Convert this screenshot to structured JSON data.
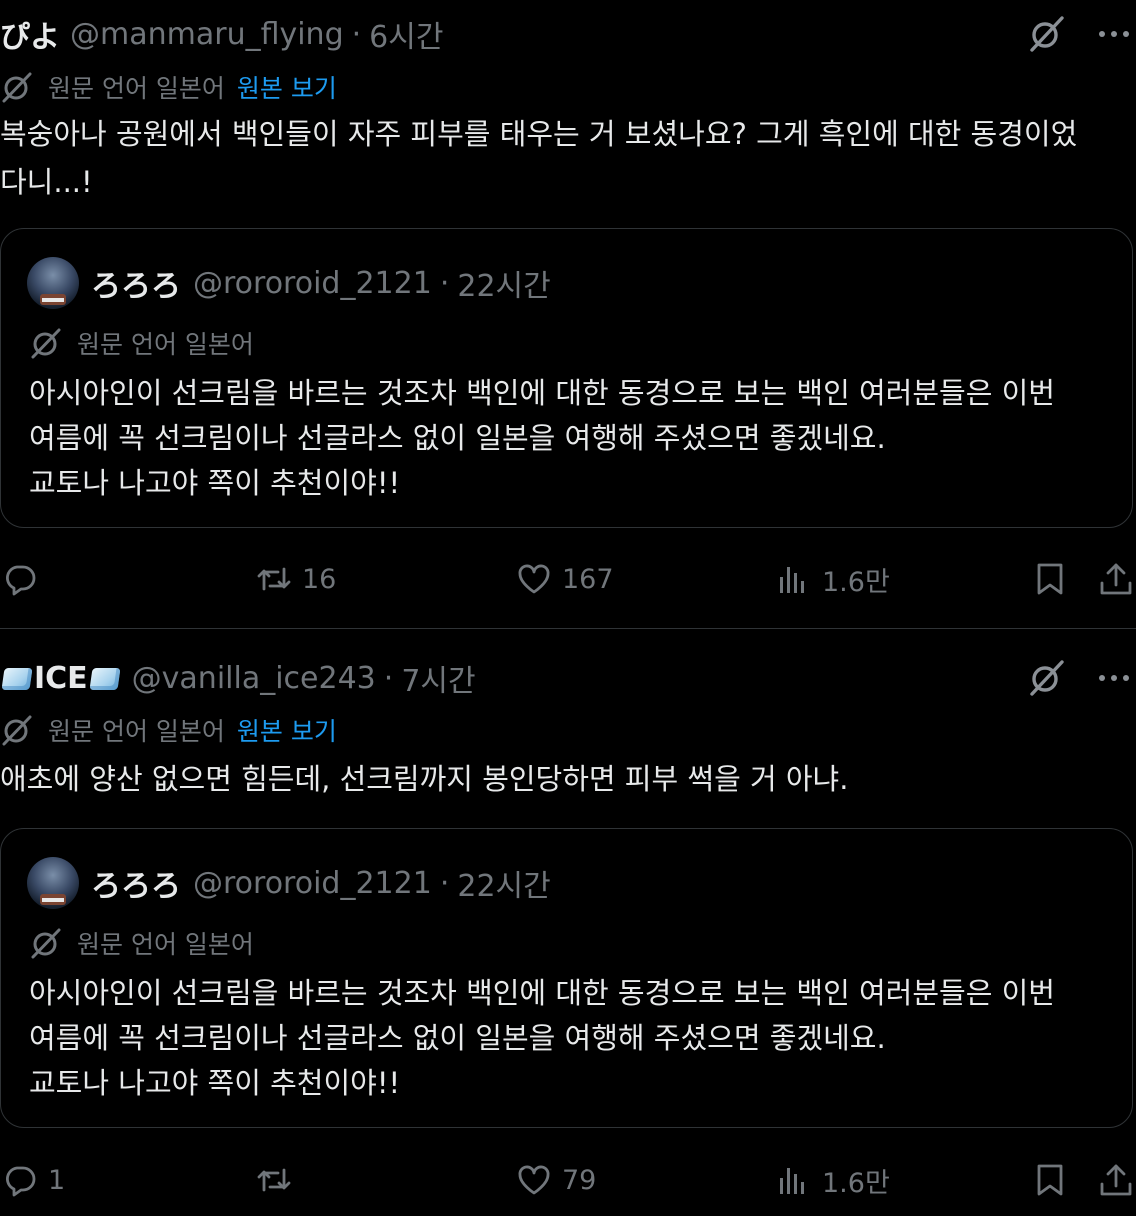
{
  "ui": {
    "translate_label": "원문 언어 일본어",
    "show_original": "원본 보기"
  },
  "posts": [
    {
      "author_name": "ぴよ",
      "handle": "@manmaru_flying",
      "separator": "·",
      "time": "6시간",
      "text": "복숭아나 공원에서 백인들이 자주 피부를 태우는 거 보셨나요? 그게 흑인에 대한 동경이었\n다니...!",
      "quote": {
        "author_name": "ろろろ",
        "handle": "@rororoid_2121",
        "separator": "·",
        "time": "22시간",
        "translate_label": "원문 언어 일본어",
        "text": "아시아인이 선크림을 바르는 것조차 백인에 대한 동경으로 보는 백인 여러분들은 이번\n여름에 꼭 선크림이나 선글라스 없이 일본을 여행해 주셨으면 좋겠네요.\n교토나 나고야 쪽이 추천이야!!"
      },
      "stats": {
        "replies": "",
        "retweets": "16",
        "likes": "167",
        "views": "1.6만"
      }
    },
    {
      "author_name": "ICE",
      "handle": "@vanilla_ice243",
      "separator": "·",
      "time": "7시간",
      "text": "애초에 양산 없으면 힘든데, 선크림까지 봉인당하면 피부 썩을 거 아냐.",
      "quote": {
        "author_name": "ろろろ",
        "handle": "@rororoid_2121",
        "separator": "·",
        "time": "22시간",
        "translate_label": "원문 언어 일본어",
        "text": "아시아인이 선크림을 바르는 것조차 백인에 대한 동경으로 보는 백인 여러분들은 이번\n여름에 꼭 선크림이나 선글라스 없이 일본을 여행해 주셨으면 좋겠네요.\n교토나 나고야 쪽이 추천이야!!"
      },
      "stats": {
        "replies": "1",
        "retweets": "",
        "likes": "79",
        "views": "1.6만"
      }
    }
  ],
  "icons": [
    "grok-icon",
    "more-icon",
    "translate-icon",
    "reply-icon",
    "retweet-icon",
    "like-icon",
    "views-icon",
    "bookmark-icon",
    "share-icon"
  ],
  "colors": {
    "background": "#000000",
    "text": "#e7e9ea",
    "muted": "#71767b",
    "link": "#1d9bf0",
    "border": "#2f3336"
  }
}
